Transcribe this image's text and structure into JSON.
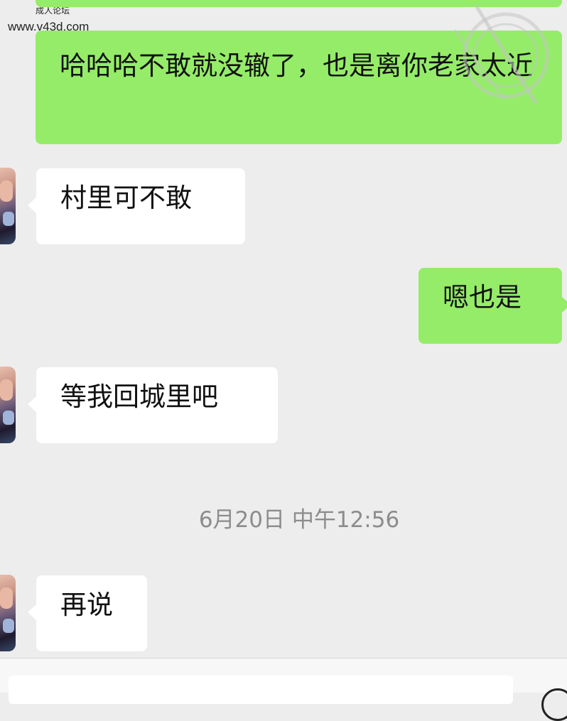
{
  "watermark": {
    "site_name": "成人论坛",
    "site_url": "www.v43d.com"
  },
  "messages": [
    {
      "side": "outgoing",
      "text": "哈哈哈不敢就没辙了，也是离你老家太近"
    },
    {
      "side": "incoming",
      "text": "村里可不敢"
    },
    {
      "side": "outgoing",
      "text": "嗯也是"
    },
    {
      "side": "incoming",
      "text": "等我回城里吧"
    },
    {
      "side": "incoming",
      "text": "再说"
    }
  ],
  "timestamp": "6月20日 中午12:56",
  "icons": {
    "avatar": "contact-avatar-photo",
    "stamp": "circular-watermark-stamp",
    "voice": "voice-toggle-icon"
  },
  "colors": {
    "background": "#ededed",
    "outgoing_bubble": "#95ec69",
    "incoming_bubble": "#ffffff",
    "timestamp_text": "#8c8c8c"
  }
}
